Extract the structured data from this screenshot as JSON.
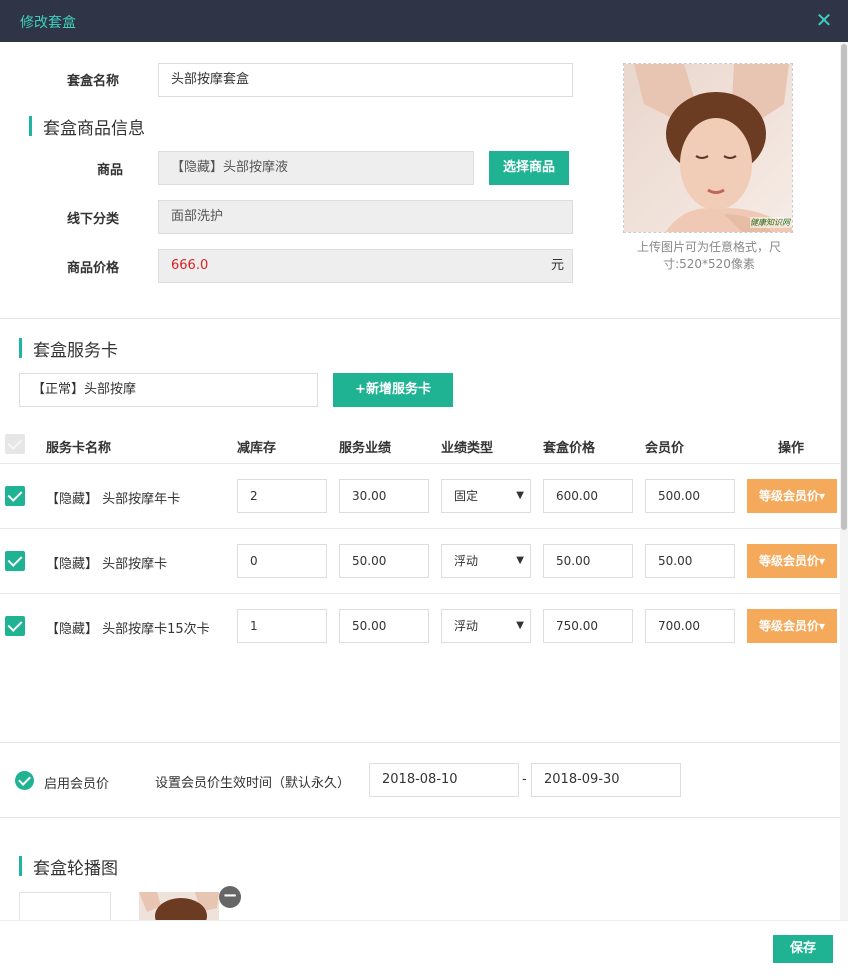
{
  "window": {
    "title": "修改套盒",
    "close": "✕"
  },
  "basic": {
    "name_label": "套盒名称",
    "name_value": "头部按摩套盒",
    "section_title": "套盒商品信息",
    "product_label": "商品",
    "product_value": "【隐藏】头部按摩液",
    "select_product_btn": "选择商品",
    "category_label": "线下分类",
    "category_value": "面部洗护",
    "price_label": "商品价格",
    "price_value": "666.0",
    "price_unit": "元",
    "upload_hint": "上传图片可为任意格式，尺寸:520*520像素",
    "watermark": "健康知识网"
  },
  "service": {
    "section_title": "套盒服务卡",
    "selected_card": "【正常】头部按摩",
    "add_card_btn": "+新增服务卡",
    "headers": [
      "服务卡名称",
      "减库存",
      "服务业绩",
      "业绩类型",
      "套盒价格",
      "会员价",
      "操作"
    ],
    "rows": [
      {
        "name": "【隐藏】 头部按摩年卡",
        "stock": "2",
        "perf": "30.00",
        "type": "固定",
        "price": "600.00",
        "member": "500.00",
        "action": "等级会员价"
      },
      {
        "name": "【隐藏】 头部按摩卡",
        "stock": "0",
        "perf": "50.00",
        "type": "浮动",
        "price": "50.00",
        "member": "50.00",
        "action": "等级会员价"
      },
      {
        "name": "【隐藏】 头部按摩卡15次卡",
        "stock": "1",
        "perf": "50.00",
        "type": "浮动",
        "price": "750.00",
        "member": "700.00",
        "action": "等级会员价"
      }
    ]
  },
  "member": {
    "enable_label": "启用会员价",
    "time_label": "设置会员价生效时间（默认永久）",
    "start_date": "2018-08-10",
    "separator": "-",
    "end_date": "2018-09-30"
  },
  "carousel": {
    "section_title": "套盒轮播图",
    "remove": "−"
  },
  "footer": {
    "save": "保存"
  },
  "colors": {
    "teal": "#1fb393",
    "orange": "#f5a95b",
    "header": "#2f3446",
    "price_red": "#e02020"
  }
}
